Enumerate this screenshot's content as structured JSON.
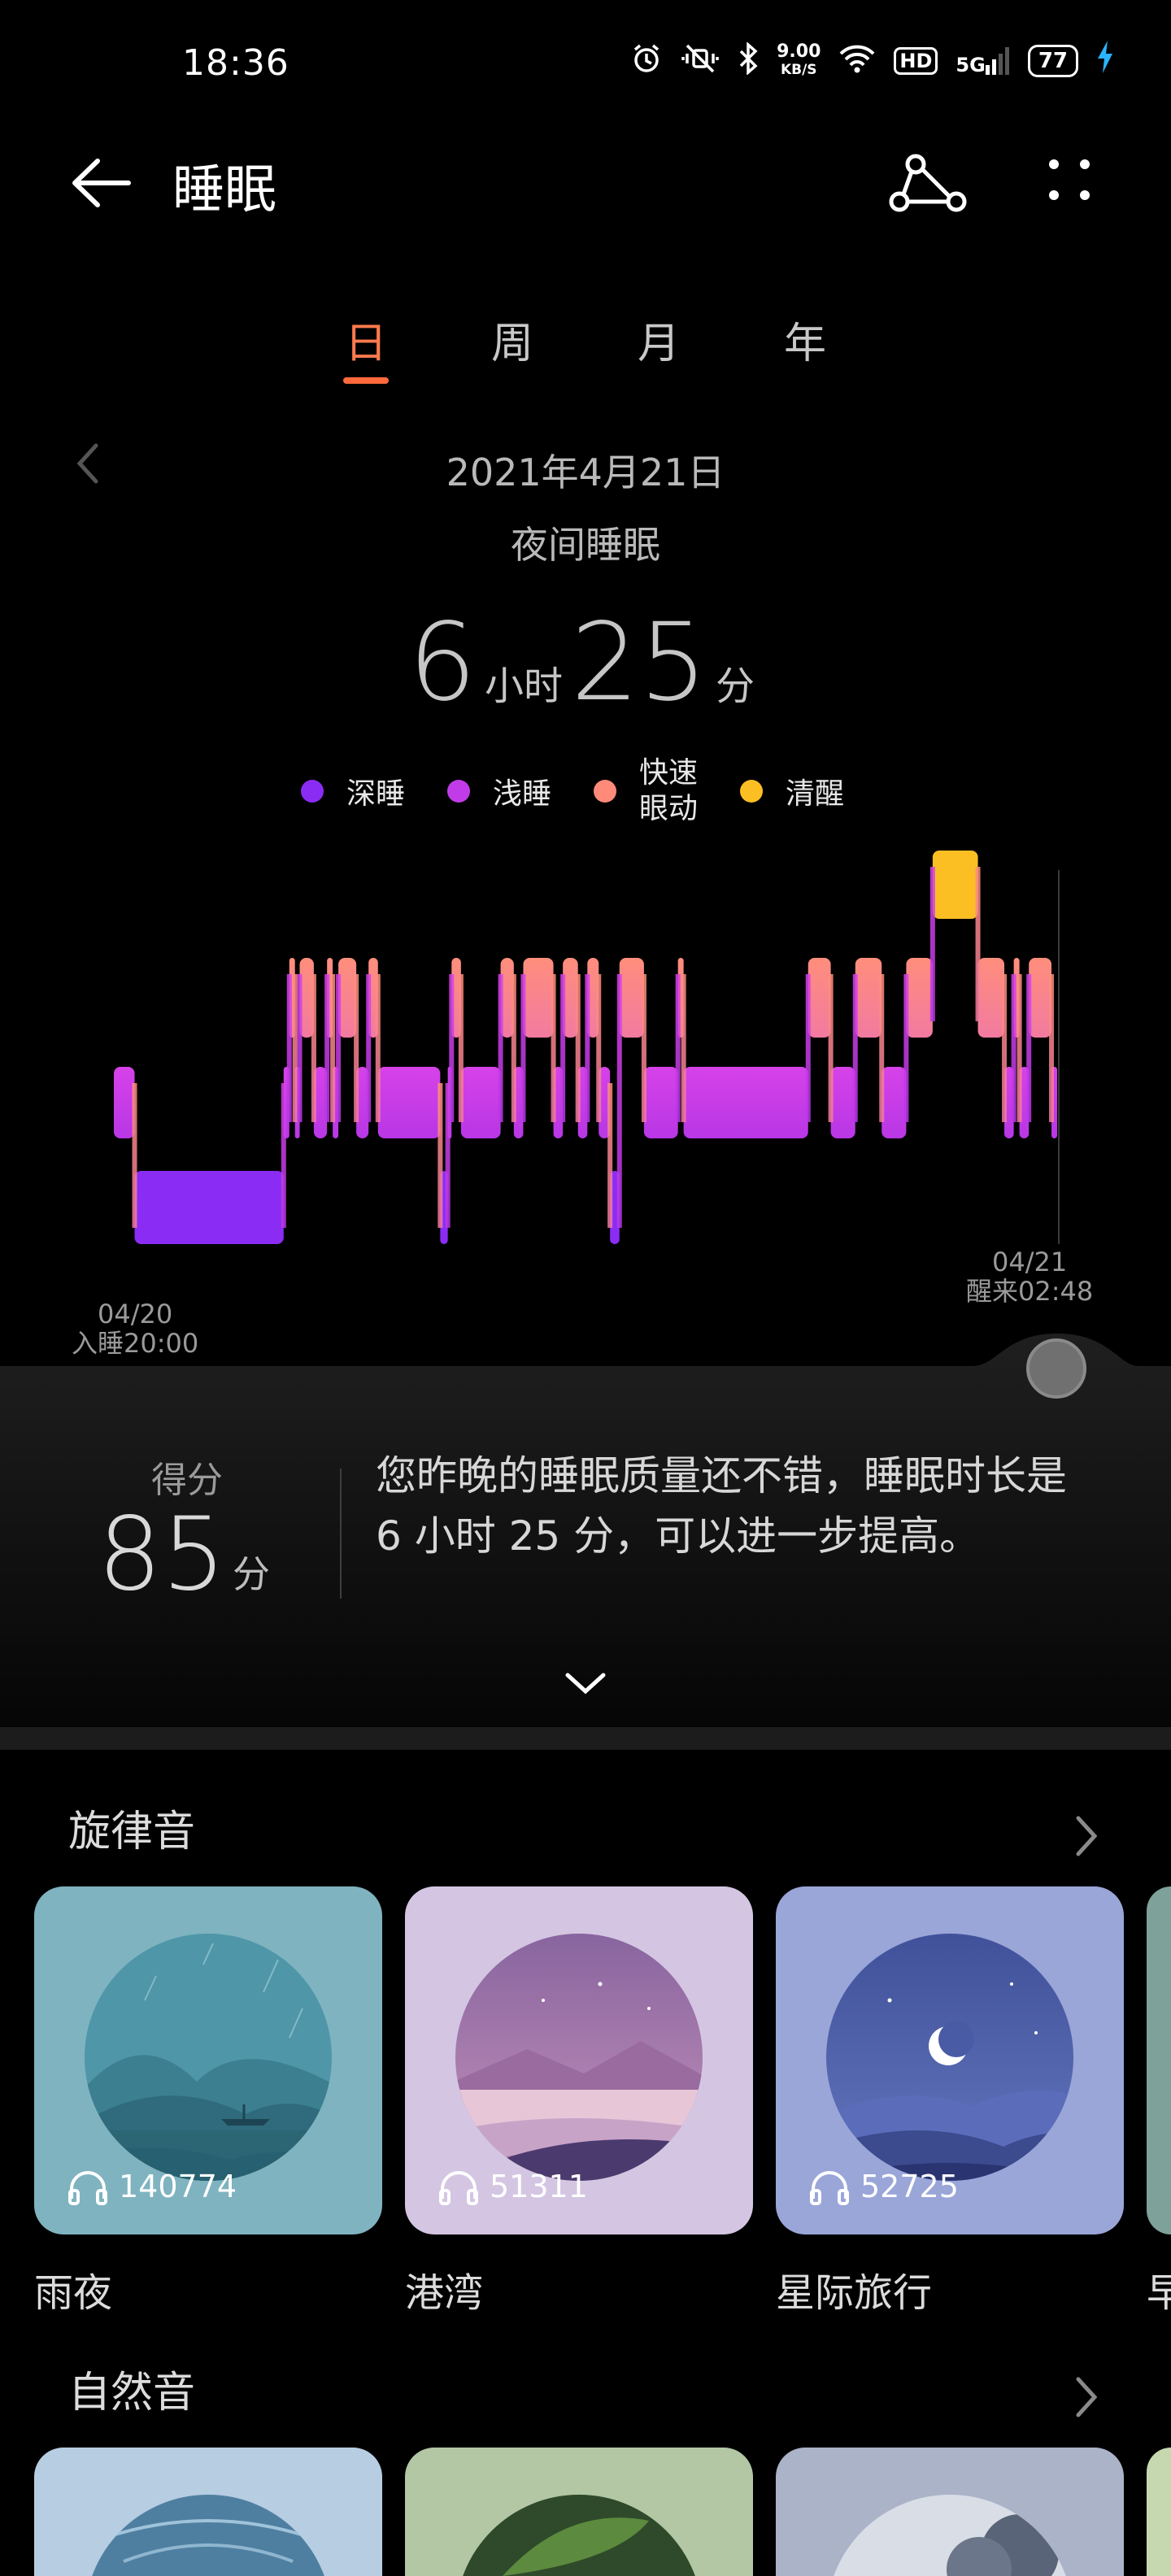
{
  "status_bar": {
    "time": "18:36",
    "net_speed_value": "9.00",
    "net_speed_unit": "KB/S",
    "hd_label": "HD",
    "network_label": "5G",
    "battery_level": "77"
  },
  "app_bar": {
    "title": "睡眠"
  },
  "tabs": [
    {
      "label": "日",
      "active": true
    },
    {
      "label": "周",
      "active": false
    },
    {
      "label": "月",
      "active": false
    },
    {
      "label": "年",
      "active": false
    }
  ],
  "summary_header": {
    "date": "2021年4月21日",
    "subtitle": "夜间睡眠",
    "hours": "6",
    "hours_unit": "小时",
    "minutes": "25",
    "minutes_unit": "分"
  },
  "legend": [
    {
      "label": "深睡",
      "color": "#8b2cf5"
    },
    {
      "label": "浅睡",
      "color": "#c13ce8"
    },
    {
      "label_line1": "快速",
      "label_line2": "眼动",
      "color": "#ff8a7a"
    },
    {
      "label": "清醒",
      "color": "#fbbf24"
    }
  ],
  "chart_data": {
    "type": "bar",
    "stages": [
      "清醒",
      "快速眼动",
      "浅睡",
      "深睡"
    ],
    "colors": {
      "清醒": "#fbbf24",
      "快速眼动": "#ff8a7a",
      "浅睡": "#c13ce8",
      "深睡": "#8b2cf5"
    },
    "start": {
      "date": "04/20",
      "label": "入睡20:00"
    },
    "end": {
      "date": "04/21",
      "label": "醒来02:48"
    },
    "segments": [
      {
        "stage": "浅睡",
        "from": 0.0,
        "to": 0.022
      },
      {
        "stage": "深睡",
        "from": 0.022,
        "to": 0.18
      },
      {
        "stage": "浅睡",
        "from": 0.18,
        "to": 0.186
      },
      {
        "stage": "快速眼动",
        "from": 0.186,
        "to": 0.192
      },
      {
        "stage": "浅睡",
        "from": 0.192,
        "to": 0.197
      },
      {
        "stage": "快速眼动",
        "from": 0.197,
        "to": 0.212
      },
      {
        "stage": "浅睡",
        "from": 0.212,
        "to": 0.226
      },
      {
        "stage": "快速眼动",
        "from": 0.226,
        "to": 0.232
      },
      {
        "stage": "浅睡",
        "from": 0.232,
        "to": 0.238
      },
      {
        "stage": "快速眼动",
        "from": 0.238,
        "to": 0.257
      },
      {
        "stage": "浅睡",
        "from": 0.257,
        "to": 0.27
      },
      {
        "stage": "快速眼动",
        "from": 0.27,
        "to": 0.28
      },
      {
        "stage": "浅睡",
        "from": 0.28,
        "to": 0.346
      },
      {
        "stage": "深睡",
        "from": 0.346,
        "to": 0.354
      },
      {
        "stage": "浅睡",
        "from": 0.354,
        "to": 0.358
      },
      {
        "stage": "快速眼动",
        "from": 0.358,
        "to": 0.368
      },
      {
        "stage": "浅睡",
        "from": 0.368,
        "to": 0.41
      },
      {
        "stage": "快速眼动",
        "from": 0.41,
        "to": 0.424
      },
      {
        "stage": "浅睡",
        "from": 0.424,
        "to": 0.434
      },
      {
        "stage": "快速眼动",
        "from": 0.434,
        "to": 0.466
      },
      {
        "stage": "浅睡",
        "from": 0.466,
        "to": 0.476
      },
      {
        "stage": "快速眼动",
        "from": 0.476,
        "to": 0.492
      },
      {
        "stage": "浅睡",
        "from": 0.492,
        "to": 0.502
      },
      {
        "stage": "快速眼动",
        "from": 0.502,
        "to": 0.514
      },
      {
        "stage": "浅睡",
        "from": 0.514,
        "to": 0.526
      },
      {
        "stage": "深睡",
        "from": 0.526,
        "to": 0.536
      },
      {
        "stage": "快速眼动",
        "from": 0.536,
        "to": 0.562
      },
      {
        "stage": "浅睡",
        "from": 0.562,
        "to": 0.598
      },
      {
        "stage": "快速眼动",
        "from": 0.598,
        "to": 0.604
      },
      {
        "stage": "浅睡",
        "from": 0.604,
        "to": 0.736
      },
      {
        "stage": "快速眼动",
        "from": 0.736,
        "to": 0.76
      },
      {
        "stage": "浅睡",
        "from": 0.76,
        "to": 0.786
      },
      {
        "stage": "快速眼动",
        "from": 0.786,
        "to": 0.814
      },
      {
        "stage": "浅睡",
        "from": 0.814,
        "to": 0.84
      },
      {
        "stage": "快速眼动",
        "from": 0.84,
        "to": 0.868
      },
      {
        "stage": "清醒",
        "from": 0.868,
        "to": 0.916
      },
      {
        "stage": "快速眼动",
        "from": 0.916,
        "to": 0.944
      },
      {
        "stage": "浅睡",
        "from": 0.944,
        "to": 0.954
      },
      {
        "stage": "快速眼动",
        "from": 0.954,
        "to": 0.96
      },
      {
        "stage": "浅睡",
        "from": 0.96,
        "to": 0.97
      },
      {
        "stage": "快速眼动",
        "from": 0.97,
        "to": 0.994
      },
      {
        "stage": "浅睡",
        "from": 0.994,
        "to": 1.0
      }
    ]
  },
  "score": {
    "label": "得分",
    "value": "85",
    "unit": "分",
    "text": "您昨晚的睡眠质量还不错，睡眠时长是6 小时 25 分，可以进一步提高。"
  },
  "melody_section": {
    "title": "旋律音",
    "items": [
      {
        "name": "雨夜",
        "plays": "140774",
        "bg": "#7fb3c0",
        "art": "rain"
      },
      {
        "name": "港湾",
        "plays": "51311",
        "bg": "#d4c6e2",
        "art": "harbor"
      },
      {
        "name": "星际旅行",
        "plays": "52725",
        "bg": "#9aa6d8",
        "art": "star"
      },
      {
        "name": "早",
        "plays": "",
        "bg": "#7ea29a",
        "art": "partial"
      }
    ]
  },
  "nature_section": {
    "title": "自然音",
    "items": [
      {
        "bg": "#b7cde2"
      },
      {
        "bg": "#b3c7a4"
      },
      {
        "bg": "#aab3c8"
      },
      {
        "bg": "#c5d8b0"
      }
    ]
  }
}
